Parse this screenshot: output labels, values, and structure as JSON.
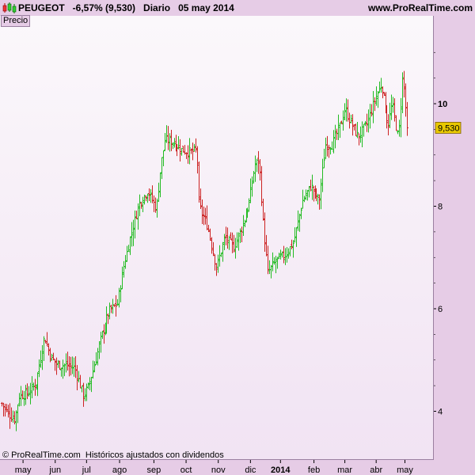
{
  "header": {
    "title": "PEUGEOT   -6,57% (9,530)   Diario   05 may 2014",
    "site": "www.ProRealTime.com"
  },
  "panel_label": "Precio",
  "footer": "© ProRealTime.com  Históricos ajustados con dividendos",
  "colors": {
    "up": "#22bb22",
    "down": "#cc2222",
    "last_price_bg": "#e8c800",
    "axis_text": "#000000"
  },
  "chart_data": {
    "type": "ohlc",
    "instrument": "PEUGEOT",
    "last_price_label": "9,530",
    "last_price": 9.53,
    "ylim": [
      3.2,
      11.2
    ],
    "yticks": [
      {
        "value": 4,
        "label": "4",
        "bold": false
      },
      {
        "value": 6,
        "label": "6",
        "bold": false
      },
      {
        "value": 8,
        "label": "8",
        "bold": false
      },
      {
        "value": 10,
        "label": "10",
        "bold": true
      }
    ],
    "xticks": [
      {
        "t": 0.05,
        "label": "may",
        "bold": false
      },
      {
        "t": 0.125,
        "label": "jun",
        "bold": false
      },
      {
        "t": 0.198,
        "label": "jul",
        "bold": false
      },
      {
        "t": 0.275,
        "label": "ago",
        "bold": false
      },
      {
        "t": 0.355,
        "label": "sep",
        "bold": false
      },
      {
        "t": 0.43,
        "label": "oct",
        "bold": false
      },
      {
        "t": 0.505,
        "label": "nov",
        "bold": false
      },
      {
        "t": 0.58,
        "label": "dic",
        "bold": false
      },
      {
        "t": 0.65,
        "label": "2014",
        "bold": true
      },
      {
        "t": 0.728,
        "label": "feb",
        "bold": false
      },
      {
        "t": 0.8,
        "label": "mar",
        "bold": false
      },
      {
        "t": 0.873,
        "label": "abr",
        "bold": false
      },
      {
        "t": 0.94,
        "label": "may",
        "bold": false
      }
    ],
    "close_path": [
      [
        0.0,
        4.15
      ],
      [
        0.015,
        3.95
      ],
      [
        0.03,
        3.85
      ],
      [
        0.04,
        4.3
      ],
      [
        0.06,
        4.35
      ],
      [
        0.08,
        4.55
      ],
      [
        0.1,
        5.45
      ],
      [
        0.115,
        5.05
      ],
      [
        0.13,
        4.9
      ],
      [
        0.15,
        4.9
      ],
      [
        0.17,
        4.85
      ],
      [
        0.19,
        4.3
      ],
      [
        0.2,
        4.45
      ],
      [
        0.215,
        4.9
      ],
      [
        0.23,
        5.4
      ],
      [
        0.25,
        5.95
      ],
      [
        0.27,
        6.1
      ],
      [
        0.285,
        6.85
      ],
      [
        0.3,
        7.4
      ],
      [
        0.32,
        8.05
      ],
      [
        0.34,
        8.3
      ],
      [
        0.36,
        7.95
      ],
      [
        0.37,
        8.8
      ],
      [
        0.38,
        9.3
      ],
      [
        0.4,
        9.25
      ],
      [
        0.42,
        9.1
      ],
      [
        0.44,
        9.05
      ],
      [
        0.455,
        9.1
      ],
      [
        0.46,
        8.0
      ],
      [
        0.48,
        7.6
      ],
      [
        0.49,
        7.2
      ],
      [
        0.5,
        6.8
      ],
      [
        0.52,
        7.4
      ],
      [
        0.54,
        7.2
      ],
      [
        0.56,
        7.6
      ],
      [
        0.575,
        8.0
      ],
      [
        0.59,
        8.8
      ],
      [
        0.6,
        8.9
      ],
      [
        0.61,
        7.6
      ],
      [
        0.62,
        6.7
      ],
      [
        0.64,
        6.95
      ],
      [
        0.66,
        7.05
      ],
      [
        0.68,
        7.3
      ],
      [
        0.7,
        8.1
      ],
      [
        0.72,
        8.4
      ],
      [
        0.74,
        8.1
      ],
      [
        0.755,
        9.2
      ],
      [
        0.77,
        9.2
      ],
      [
        0.79,
        9.6
      ],
      [
        0.8,
        9.9
      ],
      [
        0.81,
        9.7
      ],
      [
        0.83,
        9.35
      ],
      [
        0.85,
        9.6
      ],
      [
        0.87,
        10.1
      ],
      [
        0.885,
        10.4
      ],
      [
        0.9,
        9.55
      ],
      [
        0.91,
        10.0
      ],
      [
        0.925,
        9.3
      ],
      [
        0.935,
        10.6
      ],
      [
        0.945,
        9.53
      ]
    ],
    "grid": false
  }
}
